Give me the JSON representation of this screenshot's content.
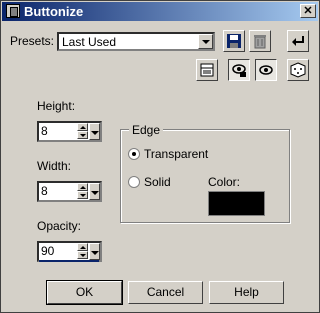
{
  "window": {
    "title": "Buttonize",
    "close_glyph": "✕"
  },
  "presets": {
    "label": "Presets:",
    "value": "Last Used"
  },
  "toolbar": {
    "save_icon": "floppy-disk",
    "delete_icon": "trash-can",
    "reset_icon": "reset-arrow",
    "preview_icon": "preview-panel",
    "proof_icons": [
      "eye-lock",
      "eye-toggle"
    ],
    "randomize_icon": "dice"
  },
  "height": {
    "label": "Height:",
    "value": "8"
  },
  "width": {
    "label": "Width:",
    "value": "8"
  },
  "opacity": {
    "label": "Opacity:",
    "value": "90"
  },
  "edge": {
    "title": "Edge",
    "transparent_label": "Transparent",
    "solid_label": "Solid",
    "selected": "Transparent",
    "color_label": "Color:",
    "color_value": "#000000"
  },
  "buttons": {
    "ok": "OK",
    "cancel": "Cancel",
    "help": "Help"
  }
}
